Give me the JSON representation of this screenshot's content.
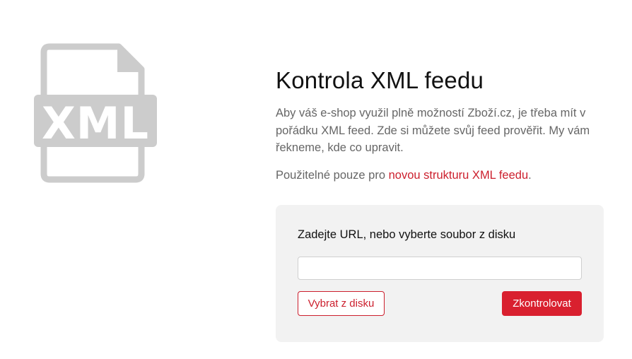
{
  "colors": {
    "accent": "#d9202f",
    "link": "#cc1f2d",
    "icon_gray": "#cccccc",
    "panel_bg": "#f2f2f2",
    "muted_text": "#666666"
  },
  "hero_icon": {
    "name": "xml-file-icon",
    "text": "XML"
  },
  "header": {
    "title": "Kontrola XML feedu",
    "intro": "Aby váš e-shop využil plně možností Zboží.cz, je třeba mít v pořádku XML feed. Zde si můžete svůj feed prověřit. My vám řekneme, kde co upravit.",
    "note_prefix": "Použitelné pouze pro ",
    "note_link": "novou strukturu XML feedu",
    "note_suffix": "."
  },
  "form": {
    "label": "Zadejte URL, nebo vyberte soubor z disku",
    "url_value": "",
    "url_placeholder": "",
    "choose_file_label": "Vybrat z disku",
    "submit_label": "Zkontrolovat"
  }
}
